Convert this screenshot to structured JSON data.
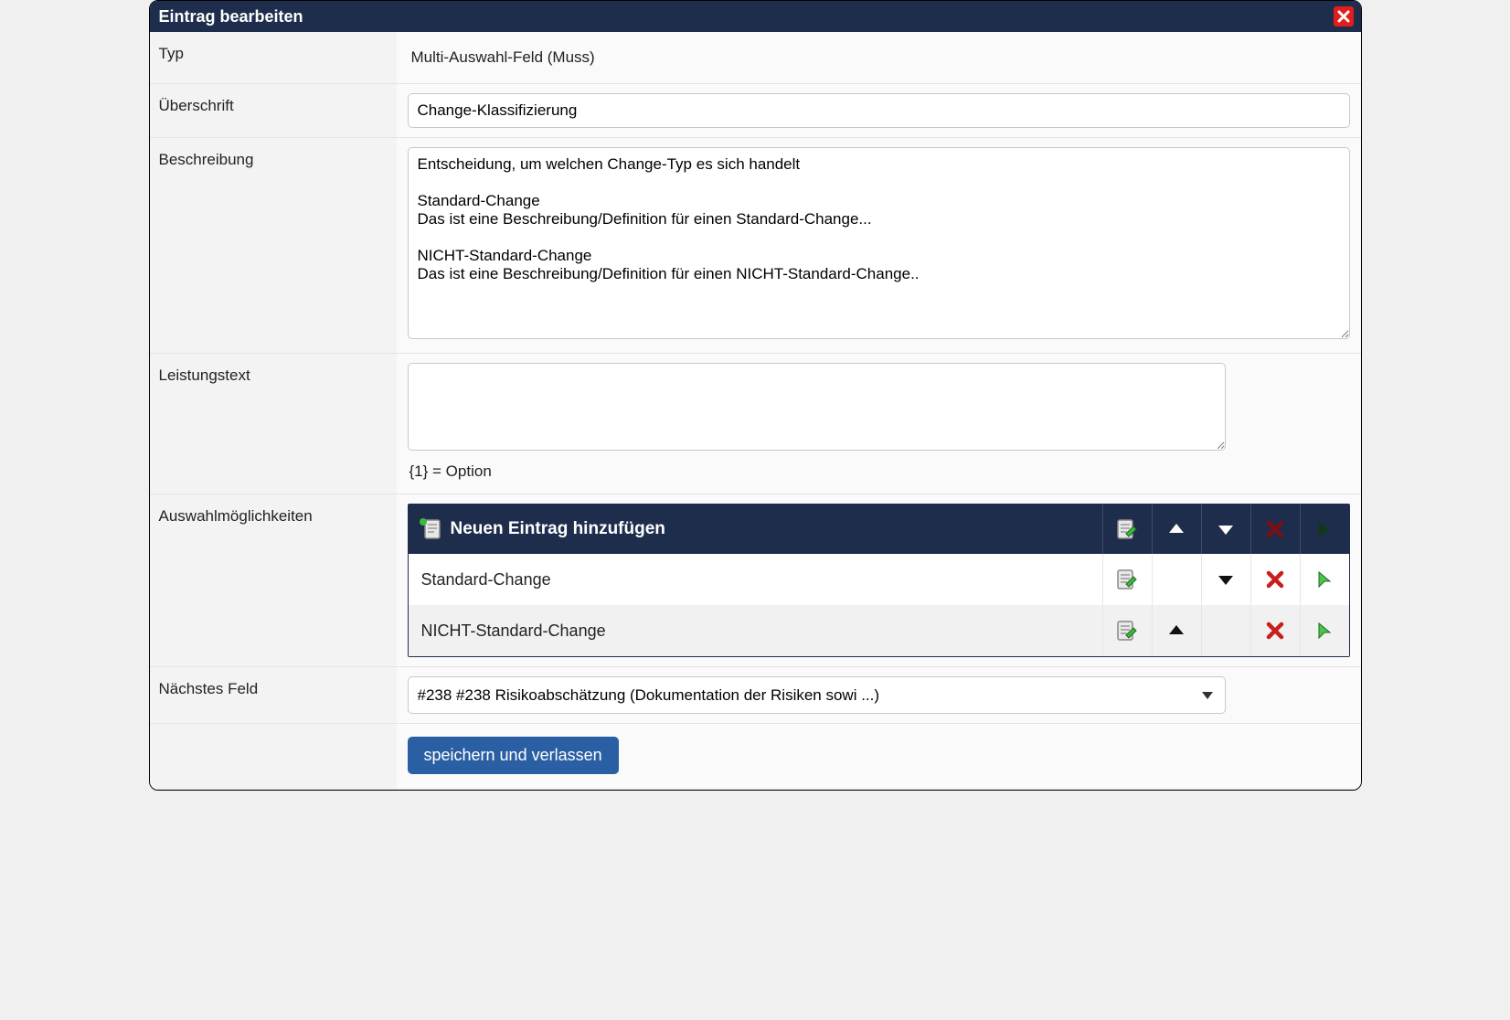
{
  "header": {
    "title": "Eintrag bearbeiten"
  },
  "form": {
    "typ_label": "Typ",
    "typ_value": "Multi-Auswahl-Feld (Muss)",
    "ueberschrift_label": "Überschrift",
    "ueberschrift_value": "Change-Klassifizierung",
    "beschreibung_label": "Beschreibung",
    "beschreibung_value": "Entscheidung, um welchen Change-Typ es sich handelt\n\nStandard-Change\nDas ist eine Beschreibung/Definition für einen Standard-Change...\n\nNICHT-Standard-Change\nDas ist eine Beschreibung/Definition für einen NICHT-Standard-Change..",
    "leistungstext_label": "Leistungstext",
    "leistungstext_value": "",
    "leistungstext_hint": "{1} = Option",
    "options_label": "Auswahlmöglichkeiten",
    "options_add_text": "Neuen Eintrag hinzufügen",
    "options": [
      {
        "name": "Standard-Change",
        "up": false,
        "down": true
      },
      {
        "name": "NICHT-Standard-Change",
        "up": true,
        "down": false
      }
    ],
    "next_field_label": "Nächstes Feld",
    "next_field_selected": "#238 #238 Risikoabschätzung (Dokumentation der Risiken sowi ...)",
    "save_label": "speichern und verlassen"
  }
}
